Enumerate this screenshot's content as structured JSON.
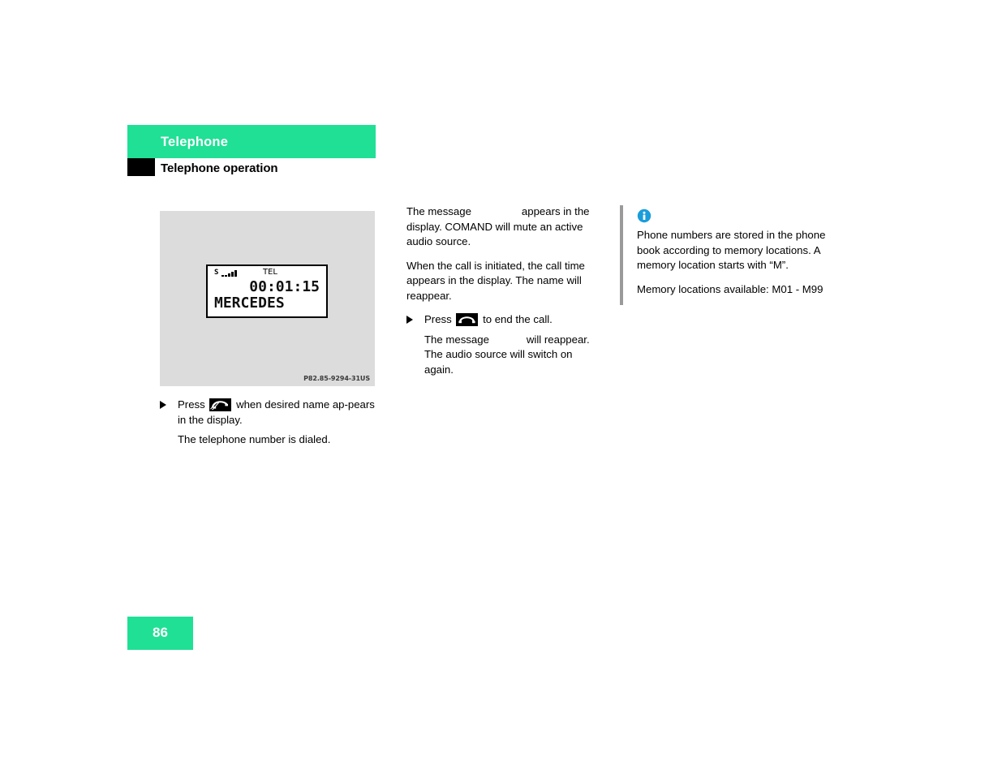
{
  "header": {
    "section_title": "Telephone",
    "subsection_title": "Telephone operation",
    "band_color": "#1fe095",
    "marker_color": "#000000"
  },
  "figure": {
    "name": "comand-display-call-active",
    "background_color": "#dcdcdc",
    "reference": "P82.85-9294-31US",
    "display": {
      "signal_label": "S",
      "signal_bars": 5,
      "mode_label": "TEL",
      "call_time": "00:01:15",
      "contact_name": "MERCEDES"
    }
  },
  "left_column": {
    "step": {
      "press_label": "Press",
      "icon_name": "phone-send-icon",
      "text_after": "when desired name ap-pears in the display."
    },
    "result": "The telephone number is dialed."
  },
  "middle_column": {
    "paragraph_1_before": "The message",
    "paragraph_1_after": "appears in the display. COMAND will mute an active audio source.",
    "paragraph_2": "When the call is initiated, the call time appears in the display. The name will reappear.",
    "step": {
      "press_label": "Press",
      "icon_name": "phone-end-icon",
      "text_after": "to end the call."
    },
    "paragraph_3_before": "The message",
    "paragraph_3_after": "will reappear. The audio source will switch on again."
  },
  "right_note": {
    "icon_name": "info-icon",
    "icon_color": "#1a9ddb",
    "rule_color": "#9a9a9a",
    "paragraph_1": "Phone numbers are stored in the phone book according to memory locations. A memory location starts with “M”.",
    "paragraph_2": "Memory locations available: M01 - M99"
  },
  "footer": {
    "page_number": "86",
    "band_color": "#1fe095"
  }
}
